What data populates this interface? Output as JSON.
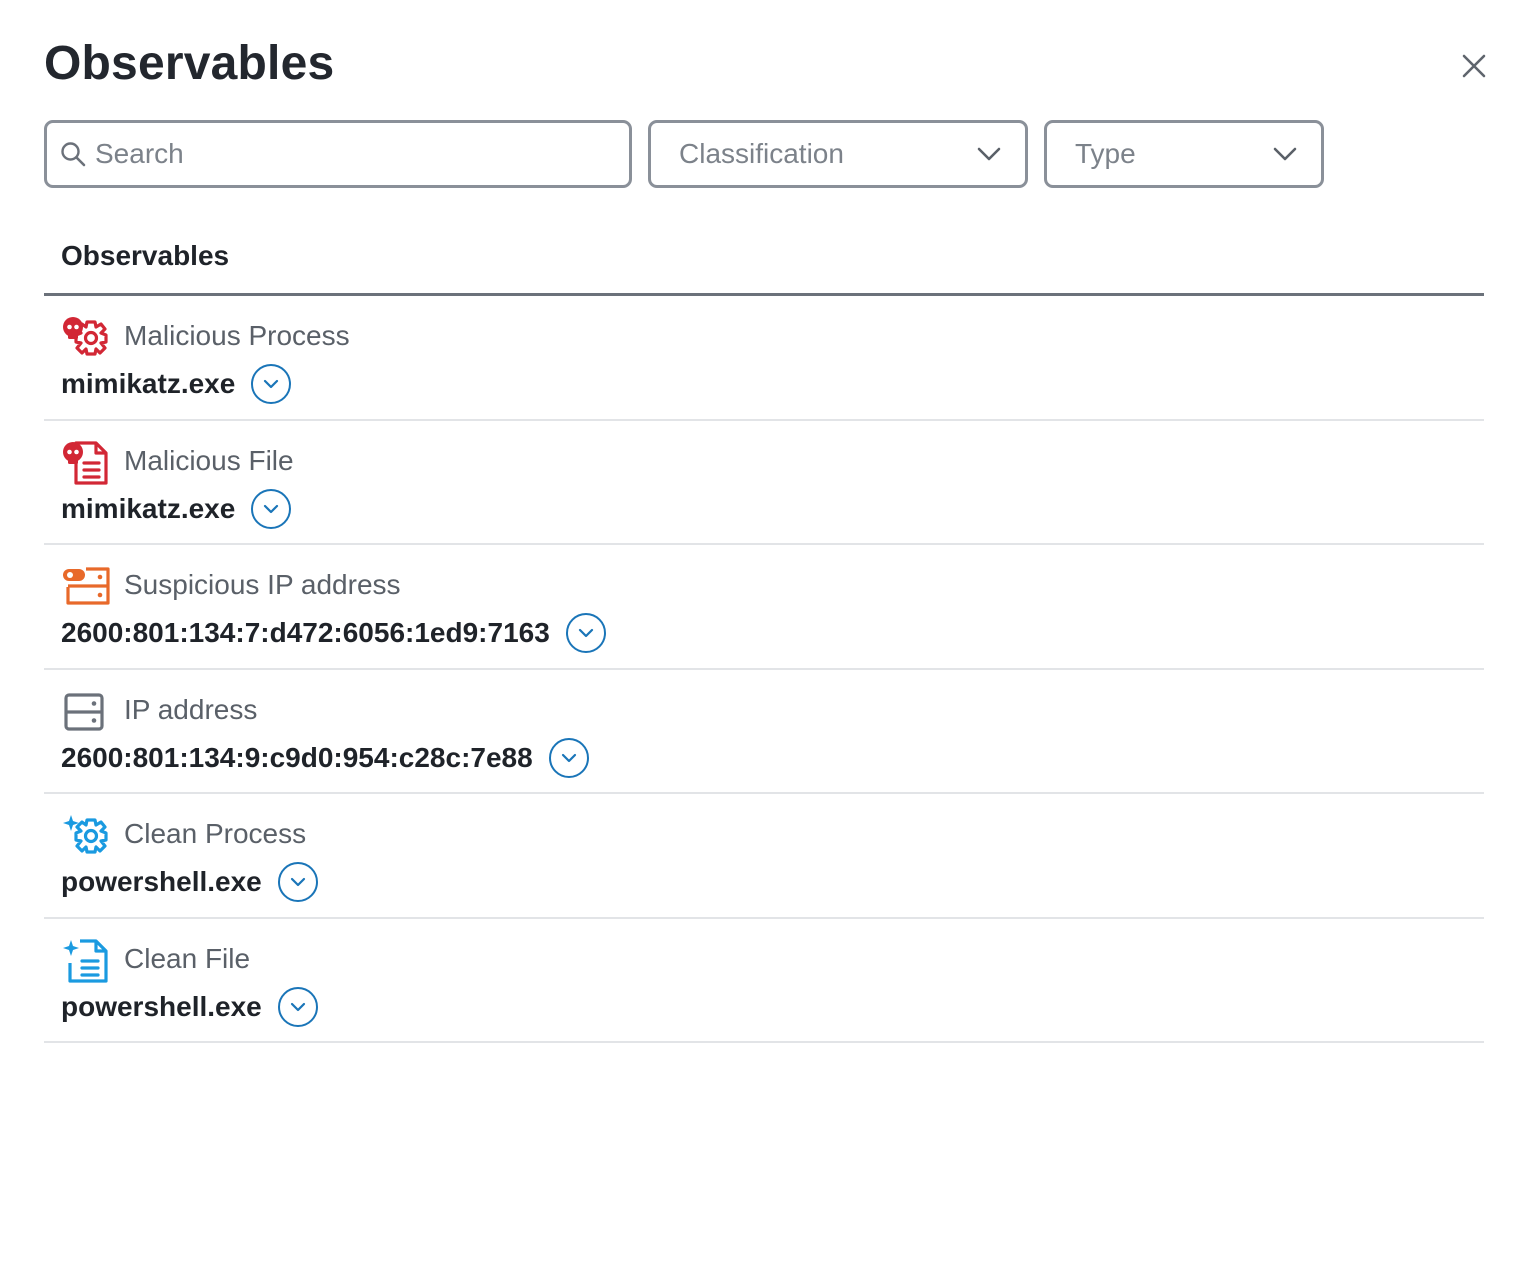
{
  "header": {
    "title": "Observables",
    "close_icon": "close-icon"
  },
  "filters": {
    "search_placeholder": "Search",
    "classification_label": "Classification",
    "type_label": "Type"
  },
  "table": {
    "column_header": "Observables",
    "rows": [
      {
        "icon": "malicious-process-icon",
        "type": "Malicious Process",
        "value": "mimikatz.exe"
      },
      {
        "icon": "malicious-file-icon",
        "type": "Malicious File",
        "value": "mimikatz.exe"
      },
      {
        "icon": "suspicious-ip-address-icon",
        "type": "Suspicious IP address",
        "value": "2600:801:134:7:d472:6056:1ed9:7163"
      },
      {
        "icon": "ip-address-icon",
        "type": "IP address",
        "value": "2600:801:134:9:c9d0:954:c28c:7e88"
      },
      {
        "icon": "clean-process-icon",
        "type": "Clean Process",
        "value": "powershell.exe"
      },
      {
        "icon": "clean-file-icon",
        "type": "Clean File",
        "value": "powershell.exe"
      }
    ]
  },
  "colors": {
    "malicious": "#d22735",
    "suspicious": "#e8692a",
    "neutral": "#6b717a",
    "clean": "#1a9ae0",
    "expand": "#1a75b8"
  }
}
